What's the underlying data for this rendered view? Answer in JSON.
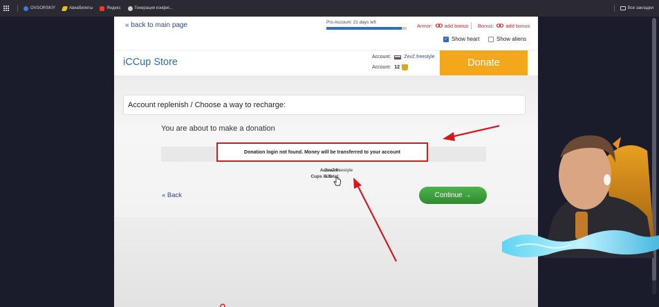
{
  "bookmarks": {
    "items": [
      {
        "label": "OVGORSKIY",
        "color": "#3a7bd5"
      },
      {
        "label": "Авиабилеты",
        "color": "#e8c020"
      },
      {
        "label": "Яндекс",
        "color": "#e04030"
      },
      {
        "label": "Генерация конфиг...",
        "color": "#cccccc"
      }
    ],
    "all_bookmarks_label": "Все закладки"
  },
  "top": {
    "back_main_label": "« back to main page",
    "pro_account_label": "Pro Account: 21 days left",
    "pro_progress": 0.94,
    "armor_label": "Armor:",
    "armor_link": "add bonus",
    "bonus_label": "Bonus:",
    "bonus_link": "add bonus",
    "show_heart_label": "Show heart",
    "show_heart_checked": true,
    "show_aliens_label": "Show aliens",
    "show_aliens_checked": false
  },
  "store": {
    "title": "iCCup Store",
    "account_label": "Account:",
    "account_name": "ZevZ.freestyle",
    "cups_label": "Account:",
    "cups_value": "12",
    "donate_label": "Donate"
  },
  "main": {
    "recharge_title": "Account replenish / Choose a way to recharge:",
    "about_text": "You are about to make a donation",
    "notice_text": "Donation login not found. Money will be transferred to your account",
    "info_account_label": "Account:",
    "info_account_value": "ZevZ.freestyle",
    "info_cups_label": "Cups in total:",
    "info_cups_value": "525",
    "back_label": "« Back",
    "continue_label": "Continue →"
  },
  "colors": {
    "annotation_red": "#d4191e",
    "donate_orange": "#f2a81a",
    "continue_green": "#3a9a3a",
    "link_blue": "#2a4a8f"
  }
}
